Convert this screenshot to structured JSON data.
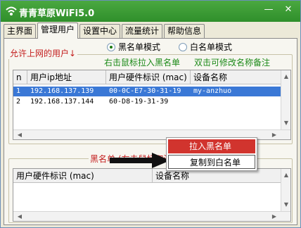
{
  "window": {
    "title": "青青草原WiFi5.0",
    "minimize": "—",
    "close": "✕"
  },
  "tabs": [
    "主界面",
    "管理用户",
    "设置中心",
    "流量统计",
    "帮助信息"
  ],
  "mode": {
    "blacklist_label": "黑名单模式",
    "whitelist_label": "白名单模式",
    "selected": "blacklist"
  },
  "allowed_group": {
    "title": "允许上网的用户↓",
    "hint_drag": "右击鼠标拉入黑名单",
    "hint_edit": "双击可修改名称备注",
    "columns": [
      "n",
      "用户ip地址",
      "用户硬件标识 (mac)",
      "设备名称"
    ],
    "rows": [
      {
        "n": "1",
        "ip": "192.168.137.139",
        "mac": "00-0C-E7-30-31-19",
        "name": "my-anzhuo"
      },
      {
        "n": "2",
        "ip": "192.168.137.144",
        "mac": "60-D8-19-31-39",
        "name": ""
      }
    ]
  },
  "context_menu": {
    "items": [
      "拉入黑名单",
      "复制到白名单"
    ]
  },
  "blacklist_group": {
    "title": "黑名单 (右击鼠标取消黑名单)",
    "columns": [
      "用户硬件标识 (mac)",
      "设备名称"
    ]
  },
  "colors": {
    "title_bar": "#2f8f2b",
    "accent_red": "#c31c1c",
    "hint_green": "#1c8a18",
    "selected_row": "#3a78d6"
  },
  "icons": {
    "app": "wifi-icon",
    "pointer": "arrow-right-icon"
  }
}
